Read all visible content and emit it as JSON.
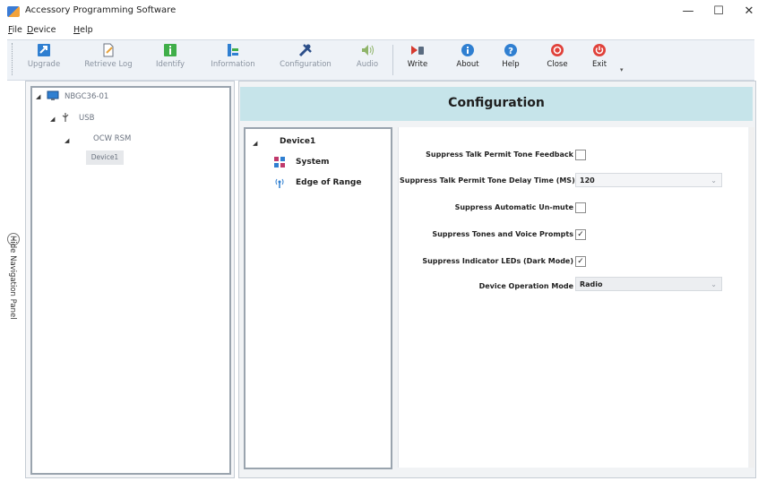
{
  "window": {
    "title": "Accessory Programming Software",
    "minimize": "—",
    "maximize": "☐",
    "close": "✕"
  },
  "menu": {
    "file": {
      "mnemonic": "F",
      "rest": "ile"
    },
    "device": {
      "mnemonic": "D",
      "rest": "evice"
    },
    "help": {
      "mnemonic": "H",
      "rest": "elp"
    }
  },
  "toolbar": {
    "upgrade": "Upgrade",
    "retrieve_log": "Retrieve Log",
    "identify": "Identify",
    "information": "Information",
    "configuration": "Configuration",
    "audio": "Audio",
    "write": "Write",
    "about": "About",
    "help": "Help",
    "close": "Close",
    "exit": "Exit",
    "overflow": "▾"
  },
  "nav": {
    "hide_label": "Hide Navigation Panel",
    "tree": {
      "root": "NBGC36-01",
      "usb": "USB",
      "device_type": "OCW RSM",
      "device": "Device1"
    }
  },
  "config": {
    "title": "Configuration",
    "tree": {
      "device": "Device1",
      "system": "System",
      "edge_of_range": "Edge of Range"
    },
    "form": {
      "talk_permit_feedback": {
        "label": "Suppress Talk Permit Tone Feedback",
        "checked": false
      },
      "talk_permit_delay": {
        "label": "Suppress Talk Permit Tone Delay Time (MS)",
        "value": "120"
      },
      "auto_unmute": {
        "label": "Suppress Automatic Un-mute",
        "checked": false
      },
      "tones_voice": {
        "label": "Suppress Tones and Voice Prompts",
        "checked": true
      },
      "indicator_leds": {
        "label": "Suppress Indicator LEDs (Dark Mode)",
        "checked": true
      },
      "operation_mode": {
        "label": "Device Operation Mode",
        "value": "Radio"
      }
    }
  },
  "icons": {
    "check": "✓",
    "caret": "⌄",
    "expand": "◢",
    "hide_nav": "‹"
  },
  "colors": {
    "header_band": "#c6e4ea",
    "toolbar_bg": "#eef2f7",
    "close_red": "#e0413a",
    "info_blue": "#2f7fd1"
  }
}
